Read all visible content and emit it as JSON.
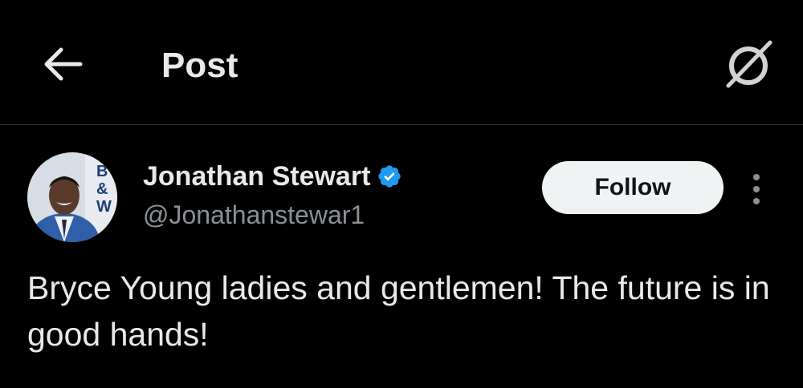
{
  "header": {
    "title": "Post",
    "back_icon": "arrow-left-icon",
    "grok_icon": "grok-icon"
  },
  "post": {
    "author": {
      "name": "Jonathan Stewart",
      "handle": "@Jonathanstewar1",
      "verified": true,
      "avatar_text": "B & W"
    },
    "follow_label": "Follow",
    "more_icon": "more-vertical-icon",
    "text": "Bryce Young ladies and gentlemen! The future is in good hands!"
  },
  "colors": {
    "background": "#000000",
    "text_primary": "#e7e9ea",
    "text_secondary": "#8b9095",
    "verified_blue": "#1d9bf0",
    "follow_button_bg": "#eff3f4",
    "divider": "#2f3336"
  }
}
